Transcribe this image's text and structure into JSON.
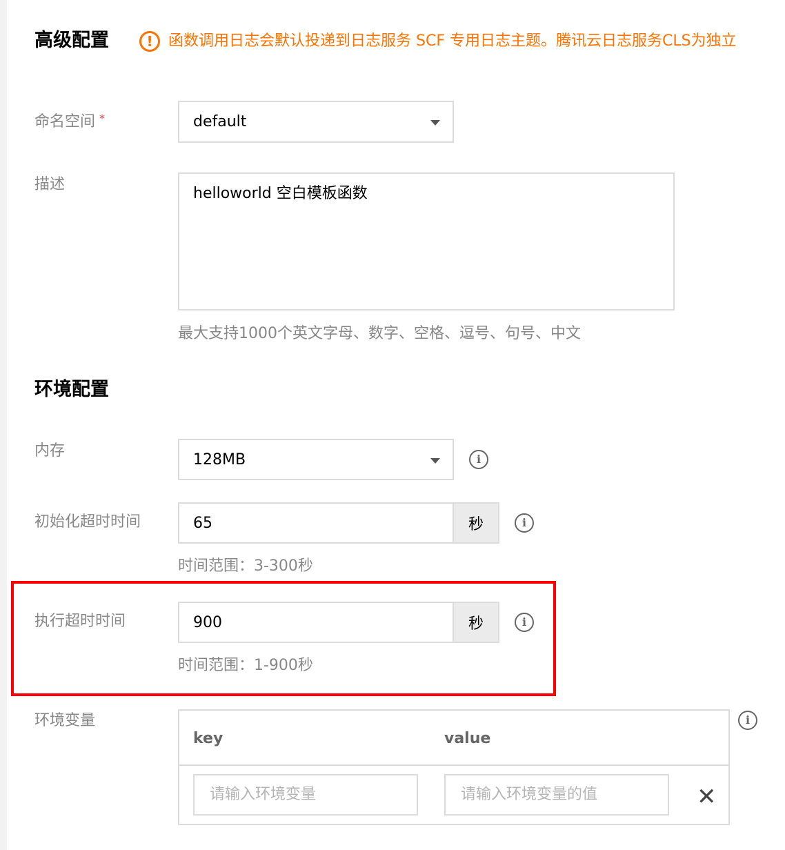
{
  "advanced": {
    "title": "高级配置",
    "notice_icon": "!",
    "notice": "函数调用日志会默认投递到日志服务 SCF 专用日志主题。腾讯云日志服务CLS为独立"
  },
  "namespace": {
    "label": "命名空间",
    "required_mark": "*",
    "value": "default"
  },
  "description": {
    "label": "描述",
    "value": "helloworld 空白模板函数",
    "hint": "最大支持1000个英文字母、数字、空格、逗号、句号、中文"
  },
  "environment": {
    "title": "环境配置",
    "memory": {
      "label": "内存",
      "value": "128MB"
    },
    "init_timeout": {
      "label": "初始化超时时间",
      "value": "65",
      "unit": "秒",
      "hint": "时间范围：3-300秒"
    },
    "exec_timeout": {
      "label": "执行超时时间",
      "value": "900",
      "unit": "秒",
      "hint": "时间范围：1-900秒"
    },
    "env_vars": {
      "label": "环境变量",
      "col_key": "key",
      "col_value": "value",
      "key_placeholder": "请输入环境变量",
      "value_placeholder": "请输入环境变量的值",
      "remove": "✕"
    }
  },
  "icons": {
    "info": "i",
    "info_icon": "info-icon",
    "warning_icon": "warning-icon",
    "caret_icon": "caret-down-icon",
    "close_icon": "close-icon"
  },
  "colors": {
    "warning": "#ff7200",
    "highlight": "#ff0000",
    "label": "#888888",
    "unit_bg": "#ebebeb",
    "border": "#dcdcdc"
  }
}
